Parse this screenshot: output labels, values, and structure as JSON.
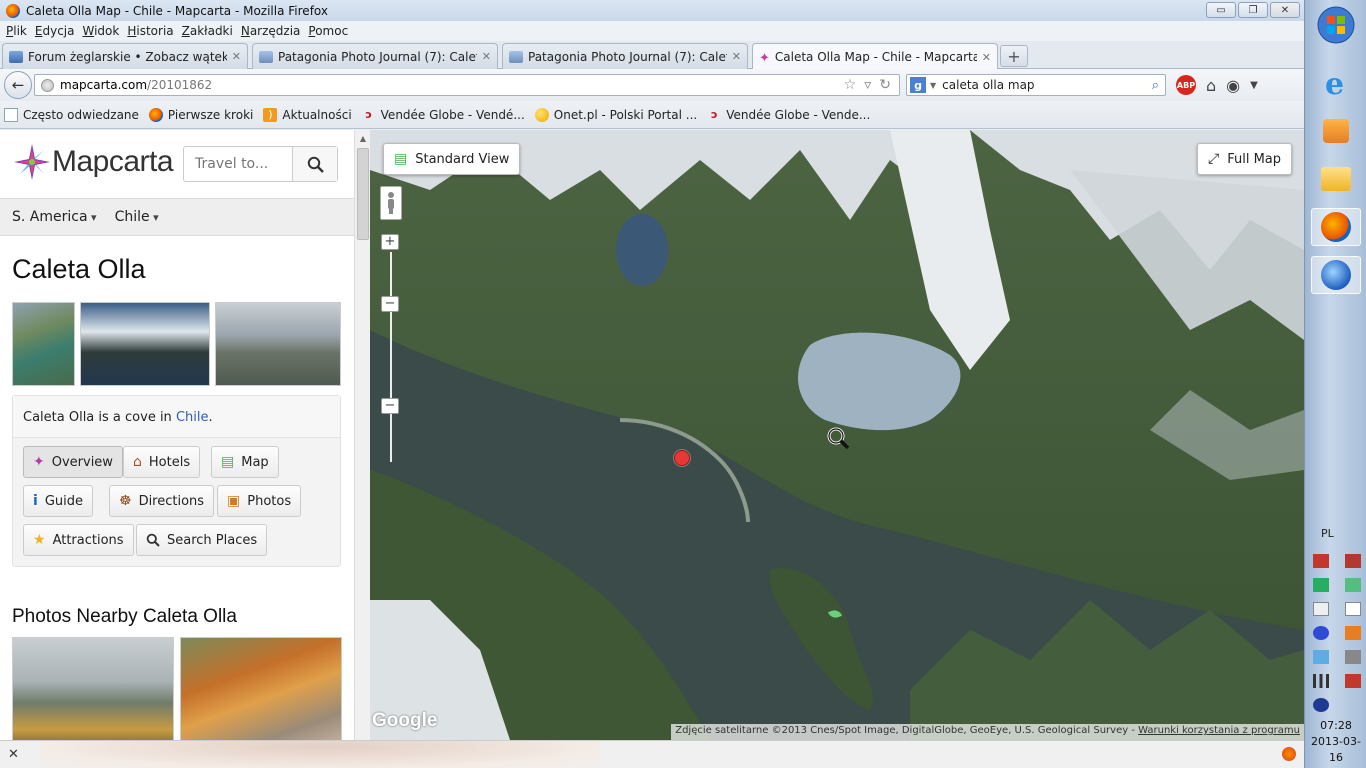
{
  "window": {
    "title": "Caleta Olla Map - Chile - Mapcarta - Mozilla Firefox",
    "controls": [
      "▭",
      "❐",
      "✕"
    ]
  },
  "menu": [
    "Plik",
    "Edycja",
    "Widok",
    "Historia",
    "Zakładki",
    "Narzędzia",
    "Pomoc"
  ],
  "tabs": [
    {
      "label": "Forum żeglarskie • Zobacz wątek - SI..."
    },
    {
      "label": "Patagonia Photo Journal (7): Caleta O..."
    },
    {
      "label": "Patagonia Photo Journal (7): Caleta O..."
    },
    {
      "label": "Caleta Olla Map - Chile - Mapcarta"
    }
  ],
  "navbar": {
    "url_host": "mapcarta.com",
    "url_path": "/20101862",
    "search_value": "caleta olla map",
    "abp": "ABP"
  },
  "bookmarks": [
    {
      "label": "Często odwiedzane",
      "icon": "doc"
    },
    {
      "label": "Pierwsze kroki",
      "icon": "ff"
    },
    {
      "label": "Aktualności",
      "icon": "rss"
    },
    {
      "label": "Vendée Globe - Vendé...",
      "icon": "red"
    },
    {
      "label": "Onet.pl - Polski Portal ...",
      "icon": "onet"
    },
    {
      "label": "Vendée Globe - Vende...",
      "icon": "red"
    }
  ],
  "site": {
    "logo": "Mapcarta",
    "search_placeholder": "Travel to...",
    "region": "S. America",
    "country": "Chile",
    "place_title": "Caleta Olla",
    "description_prefix": "Caleta Olla is a cove in ",
    "description_link": "Chile",
    "description_suffix": ".",
    "buttons": {
      "overview": "Overview",
      "hotels": "Hotels",
      "map": "Map",
      "guide": "Guide",
      "directions": "Directions",
      "photos": "Photos",
      "attractions": "Attractions",
      "search_places": "Search Places"
    },
    "nearby_title": "Photos Nearby Caleta Olla"
  },
  "map": {
    "standard_view": "Standard View",
    "full_map": "Full Map",
    "google": "Google",
    "attribution": "Zdjęcie satelitarne ©2013 Cnes/Spot Image, DigitalGlobe, GeoEye, U.S. Geological Survey - ",
    "terms": "Warunki korzystania z programu",
    "colors": {
      "water": "#3c4d4b",
      "forest": "#3f5a35",
      "snow": "#e8ecef"
    }
  },
  "statusbar": {
    "close": "✕"
  },
  "taskbar": {
    "lang": "PL",
    "time": "07:28",
    "date": "2013-03-16"
  }
}
